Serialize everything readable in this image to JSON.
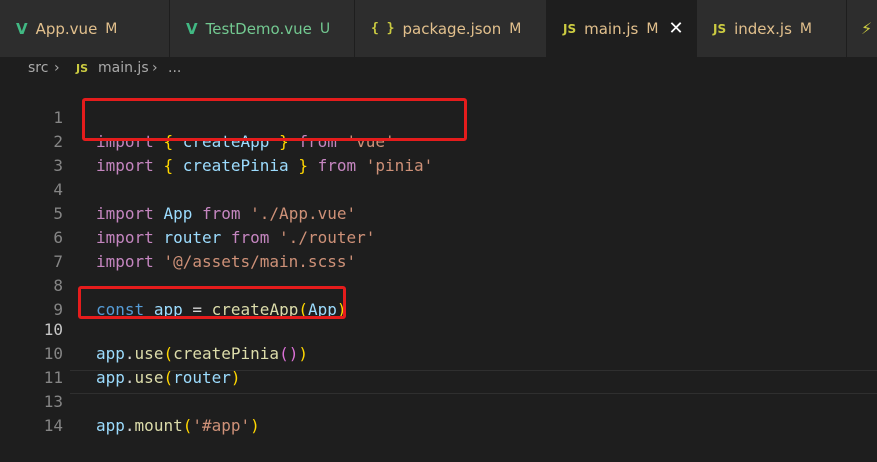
{
  "tabs": [
    {
      "name": "App.vue",
      "status": "M",
      "icon": "vue-icon"
    },
    {
      "name": "TestDemo.vue",
      "status": "U",
      "icon": "vue-icon"
    },
    {
      "name": "package.json",
      "status": "M",
      "icon": "json-icon"
    },
    {
      "name": "main.js",
      "status": "M",
      "icon": "js-icon",
      "active": true
    },
    {
      "name": "index.js",
      "status": "M",
      "icon": "js-icon"
    }
  ],
  "icons": {
    "vue": "V",
    "json": "{ }",
    "js": "JS",
    "close": "✕",
    "chevron": "›",
    "bolt": "⚡"
  },
  "breadcrumb": {
    "folder": "src",
    "file": "main.js",
    "more": "..."
  },
  "code": {
    "line_numbers": [
      "1",
      "2",
      "3",
      "4",
      "5",
      "6",
      "7",
      "8",
      "9",
      "10",
      "10",
      "11",
      "13",
      "14"
    ],
    "l1": {
      "kw": "import",
      "ob": "{",
      "id": "createApp",
      "cb": "}",
      "from": "from",
      "str": "'vue'"
    },
    "l2": {
      "kw": "import",
      "ob": "{",
      "id": "createPinia",
      "cb": "}",
      "from": "from",
      "str": "'pinia'"
    },
    "l4": {
      "kw": "import",
      "id": "App",
      "from": "from",
      "str": "'./App.vue'"
    },
    "l5": {
      "kw": "import",
      "id": "router",
      "from": "from",
      "str": "'./router'"
    },
    "l6": {
      "kw": "import",
      "str": "'@/assets/main.scss'"
    },
    "l8": {
      "kw": "const",
      "id": "app",
      "eq": "=",
      "fn": "createApp",
      "op": "(",
      "arg": "App",
      "cp": ")"
    },
    "l10": {
      "obj": "app",
      "dot": ".",
      "fn": "use",
      "op": "(",
      "fn2": "createPinia",
      "ip": "()",
      "cp": ")"
    },
    "l10b": {
      "obj": "app",
      "dot": ".",
      "fn": "use",
      "op": "(",
      "arg": "router",
      "cp": ")"
    },
    "l13": {
      "obj": "app",
      "dot": ".",
      "fn": "mount",
      "op": "(",
      "str": "'#app'",
      "cp": ")"
    }
  }
}
